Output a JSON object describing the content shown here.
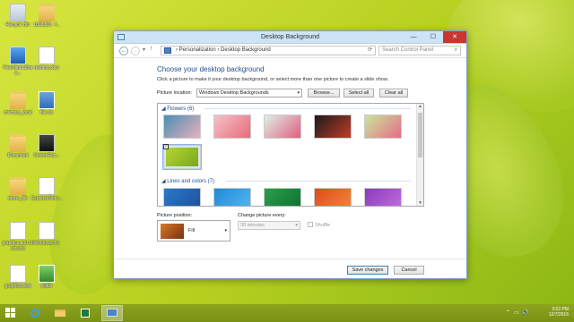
{
  "desktop": {
    "icons": [
      {
        "name": "recycle-bin-icon",
        "label": "Recycle Bin"
      },
      {
        "name": "folder-icon",
        "label": "1d03d03 - f..."
      },
      {
        "name": "this-pc-icon",
        "label": "FreeMind Share..."
      },
      {
        "name": "file-icon",
        "label": "memory.xlsx"
      },
      {
        "name": "folder-icon",
        "label": "memory_local"
      },
      {
        "name": "image-icon",
        "label": "file.xls"
      },
      {
        "name": "folder-icon",
        "label": "Document"
      },
      {
        "name": "screenshot-icon",
        "label": "ScreenRec..."
      },
      {
        "name": "folder-icon",
        "label": "demo_file"
      },
      {
        "name": "file-icon",
        "label": "ExpenseNote..."
      },
      {
        "name": "file-icon",
        "label": "graphics and chart.xlsx"
      },
      {
        "name": "file-icon",
        "label": "Windows 8.1"
      },
      {
        "name": "file-icon",
        "label": "graphics.xlsx"
      },
      {
        "name": "app-icon",
        "label": "xlsfile"
      }
    ]
  },
  "window": {
    "title": "Desktop Background",
    "min": "—",
    "max": "☐",
    "close": "✕",
    "nav": {
      "back": "←",
      "forward": "→",
      "up": "↑",
      "dropdown": "▾"
    },
    "address": {
      "root": "Personalization",
      "sep": "›",
      "current": "Desktop Background",
      "refresh": "⟳"
    },
    "search": {
      "placeholder": "Search Control Panel",
      "icon": "⌕"
    }
  },
  "content": {
    "heading": "Choose your desktop background",
    "description": "Click a picture to make it your desktop background, or select more than one picture to create a slide show.",
    "location_label": "Picture location:",
    "location_value": "Windows Desktop Backgrounds",
    "browse": "Browse...",
    "select_all": "Select all",
    "clear_all": "Clear all"
  },
  "gallery": {
    "groups": [
      {
        "name": "Flowers (6)",
        "collapse": "◢"
      },
      {
        "name": "Lines and colors (7)",
        "collapse": "◢"
      }
    ],
    "flowers": [
      {
        "colors": [
          "#4a8fb0",
          "#e8b0c0"
        ]
      },
      {
        "colors": [
          "#f3c2c8",
          "#e86b7a"
        ]
      },
      {
        "colors": [
          "#dff0e8",
          "#e25f80"
        ]
      },
      {
        "colors": [
          "#1a1a1a",
          "#c23b2a"
        ]
      },
      {
        "colors": [
          "#c8e69a",
          "#e66d8a"
        ]
      },
      {
        "colors": [
          "#b4d438",
          "#7aa81b"
        ]
      }
    ],
    "lines": [
      {
        "colors": [
          "#2c78c8",
          "#1d4f9a"
        ]
      },
      {
        "colors": [
          "#1e8ad8",
          "#56b8f2"
        ]
      },
      {
        "colors": [
          "#2aa04a",
          "#0d6e2e"
        ]
      },
      {
        "colors": [
          "#e04a1a",
          "#f28a3a"
        ]
      },
      {
        "colors": [
          "#8a3ab8",
          "#c270e0"
        ]
      }
    ],
    "checkmark": "✓"
  },
  "position": {
    "label": "Picture position:",
    "value": "Fill",
    "arrow": "▾"
  },
  "interval": {
    "label": "Change picture every:",
    "value": "30 minutes",
    "arrow": "▾",
    "shuffle_label": "Shuffle"
  },
  "footer": {
    "save": "Save changes",
    "cancel": "Cancel"
  },
  "taskbar": {
    "time": "3:52 PM",
    "date": "12/7/2016",
    "tray_icons": [
      "⌃",
      "▭",
      "🔊"
    ]
  }
}
